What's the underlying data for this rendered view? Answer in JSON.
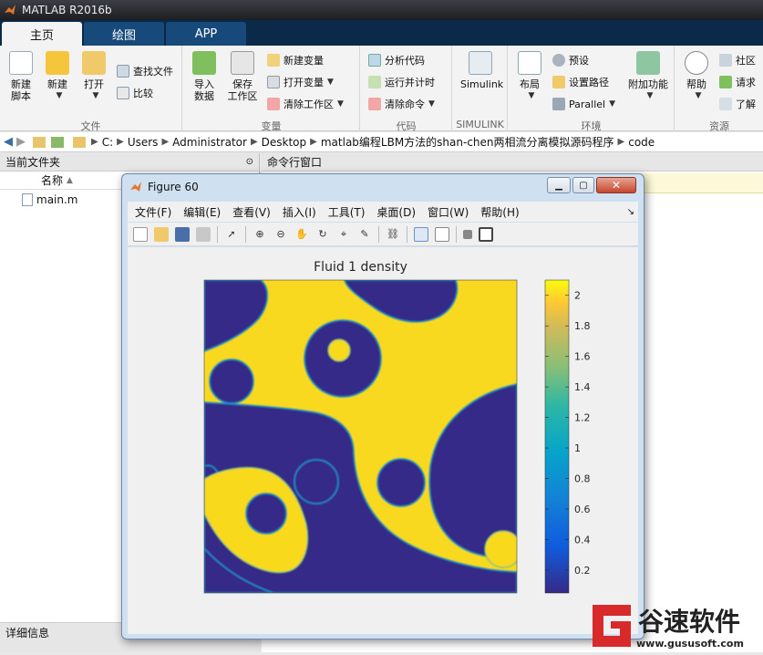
{
  "app_title": "MATLAB R2016b",
  "tabs": [
    {
      "label": "主页"
    },
    {
      "label": "绘图"
    },
    {
      "label": "APP"
    }
  ],
  "ribbon": {
    "file": {
      "new_script": [
        "新建",
        "脚本"
      ],
      "new": "新建",
      "open": "打开",
      "find_files": "查找文件",
      "compare": "比较",
      "label": "文件"
    },
    "variable": {
      "import": [
        "导入",
        "数据"
      ],
      "save": [
        "保存",
        "工作区"
      ],
      "new_var": "新建变量",
      "open_var": "打开变量",
      "clear_ws": "清除工作区",
      "label": "变量"
    },
    "code": {
      "analyze": "分析代码",
      "run_time": "运行并计时",
      "clear_cmd": "清除命令",
      "label": "代码"
    },
    "simulink": {
      "button": "Simulink",
      "label": "SIMULINK"
    },
    "env": {
      "layout": "布局",
      "prefs": "预设",
      "set_path": "设置路径",
      "parallel": "Parallel",
      "addons": "附加功能",
      "label": "环境"
    },
    "resources": {
      "help": "帮助",
      "community": "社区",
      "request": "请求",
      "learn": "了解",
      "label": "资源"
    }
  },
  "breadcrumb": [
    "C:",
    "Users",
    "Administrator",
    "Desktop",
    "matlab编程LBM方法的shan-chen两相流分离模拟源码程序",
    "code"
  ],
  "left_panel": {
    "title": "当前文件夹",
    "column_name": "名称",
    "files": [
      "main.m"
    ],
    "details": "详细信息"
  },
  "command_window": {
    "title": "命令行窗口"
  },
  "figure": {
    "title": "Figure 60",
    "menu": [
      "文件(F)",
      "编辑(E)",
      "查看(V)",
      "插入(I)",
      "工具(T)",
      "桌面(D)",
      "窗口(W)",
      "帮助(H)"
    ],
    "toolbar_icons": [
      "new-figure-icon",
      "open-icon",
      "save-icon",
      "print-icon",
      "pointer-icon",
      "zoom-in-icon",
      "zoom-out-icon",
      "pan-icon",
      "rotate-icon",
      "data-cursor-icon",
      "brush-icon",
      "link-icon",
      "colorbar-icon",
      "legend-icon",
      "hide-plot-tools-icon",
      "show-plot-tools-icon"
    ],
    "plot_title": "Fluid 1 density",
    "colorbar_ticks": [
      "2",
      "1.8",
      "1.6",
      "1.4",
      "1.2",
      "1",
      "0.8",
      "0.6",
      "0.4",
      "0.2"
    ]
  },
  "colors": {
    "low": "#352a87",
    "high": "#f9d91f",
    "tab_bar": "#0b2a49",
    "tab_active": "#f3f3f3"
  },
  "chart_data": {
    "type": "heatmap",
    "title": "Fluid 1 density",
    "colormap": "parula",
    "clim": [
      0.05,
      2.1
    ],
    "colorbar_ticks": [
      2,
      1.8,
      1.6,
      1.4,
      1.2,
      1,
      0.8,
      0.6,
      0.4,
      0.2
    ],
    "values_description": "two-phase field: low density (~0.05) blue regions and high density (~2.1) yellow regions"
  },
  "watermark": {
    "brand": "谷速软件",
    "url": "www.gususoft.com"
  }
}
